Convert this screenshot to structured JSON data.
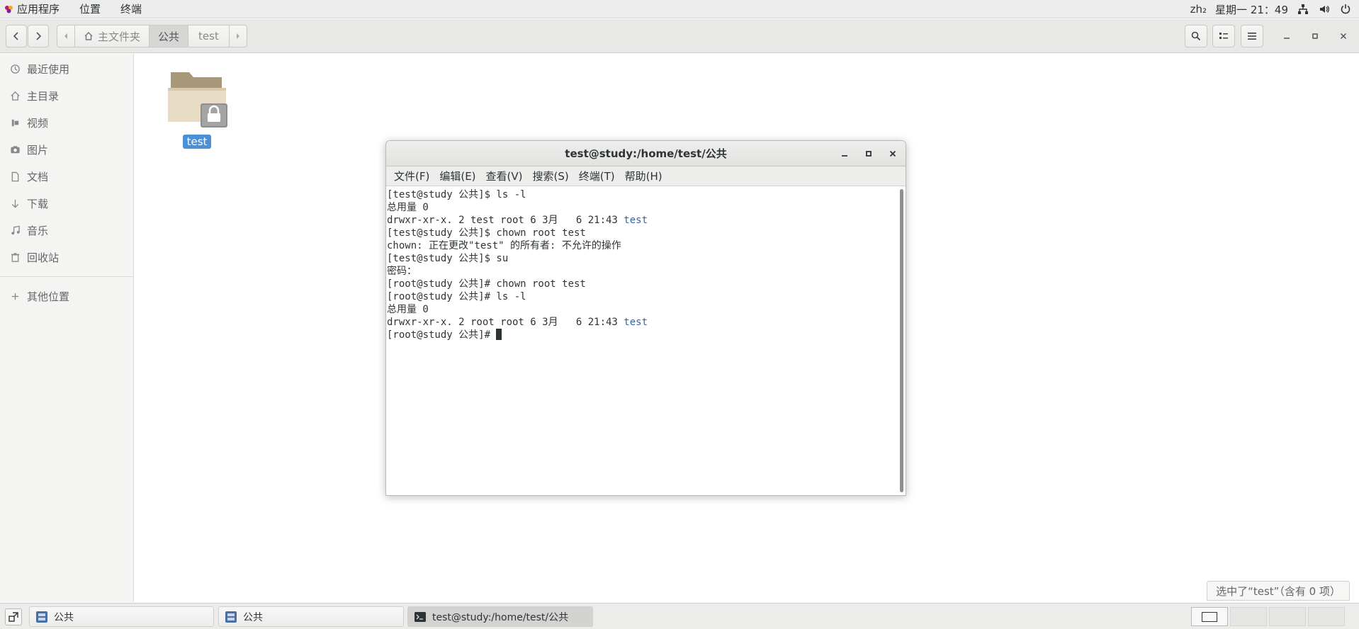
{
  "topbar": {
    "menus": [
      "应用程序",
      "位置",
      "终端"
    ],
    "input_method": "zh₂",
    "datetime": "星期一 21：49"
  },
  "nautilus": {
    "path": [
      "主文件夹",
      "公共",
      "test"
    ],
    "status": "选中了“test”（含有 0 项）"
  },
  "sidebar": {
    "items": [
      {
        "label": "最近使用",
        "icon": "clock-icon"
      },
      {
        "label": "主目录",
        "icon": "home-icon"
      },
      {
        "label": "视频",
        "icon": "video-icon"
      },
      {
        "label": "图片",
        "icon": "camera-icon"
      },
      {
        "label": "文档",
        "icon": "document-icon"
      },
      {
        "label": "下载",
        "icon": "download-icon"
      },
      {
        "label": "音乐",
        "icon": "music-icon"
      },
      {
        "label": "回收站",
        "icon": "trash-icon"
      }
    ],
    "other": "其他位置"
  },
  "content": {
    "folder_name": "test"
  },
  "terminal": {
    "title": "test@study:/home/test/公共",
    "menu": [
      "文件(F)",
      "编辑(E)",
      "查看(V)",
      "搜索(S)",
      "终端(T)",
      "帮助(H)"
    ],
    "lines": [
      "[test@study 公共]$ ls -l",
      "总用量 0",
      "drwxr-xr-x. 2 test root 6 3月   6 21:43 ",
      "[test@study 公共]$ chown root test",
      "chown: 正在更改\"test\" 的所有者: 不允许的操作",
      "[test@study 公共]$ su",
      "密码：",
      "[root@study 公共]# chown root test",
      "[root@study 公共]# ls -l",
      "总用量 0",
      "drwxr-xr-x. 2 root root 6 3月   6 21:43 ",
      "[root@study 公共]# "
    ],
    "dir_name": "test"
  },
  "taskbar": {
    "tasks": [
      "公共",
      "公共",
      "test@study:/home/test/公共"
    ]
  }
}
